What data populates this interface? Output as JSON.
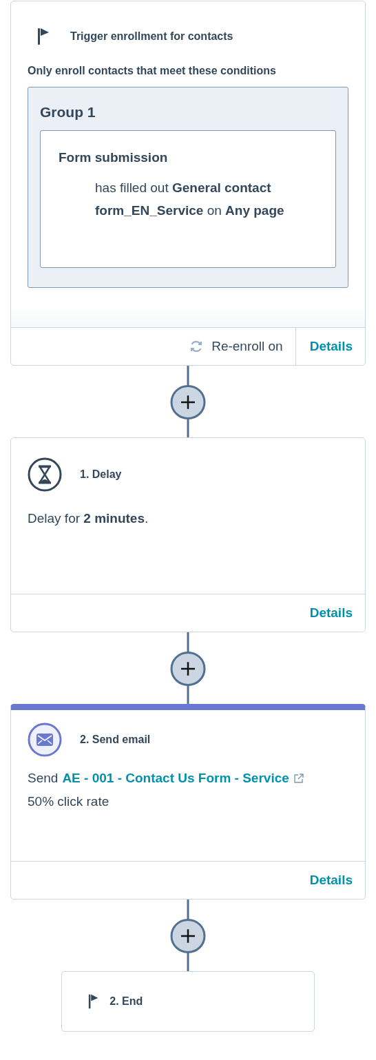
{
  "trigger": {
    "title": "Trigger enrollment for contacts",
    "subtitle": "Only enroll contacts that meet these conditions",
    "group": {
      "title": "Group 1",
      "condition": {
        "title": "Form submission",
        "text": "has filled out **General contact form_EN_Service** on **Any page**"
      }
    },
    "reenroll": "Re-enroll on",
    "details": "Details"
  },
  "actions": [
    {
      "kind": "delay",
      "title": "1. Delay",
      "text": "Delay for **2 minutes**.",
      "details": "Details"
    },
    {
      "kind": "email",
      "title": "2. Send email",
      "prefix": "Send",
      "link": "AE - 001 - Contact Us Form - Service",
      "stat": "50% click rate",
      "details": "Details"
    }
  ],
  "end": {
    "title": "2. End"
  }
}
